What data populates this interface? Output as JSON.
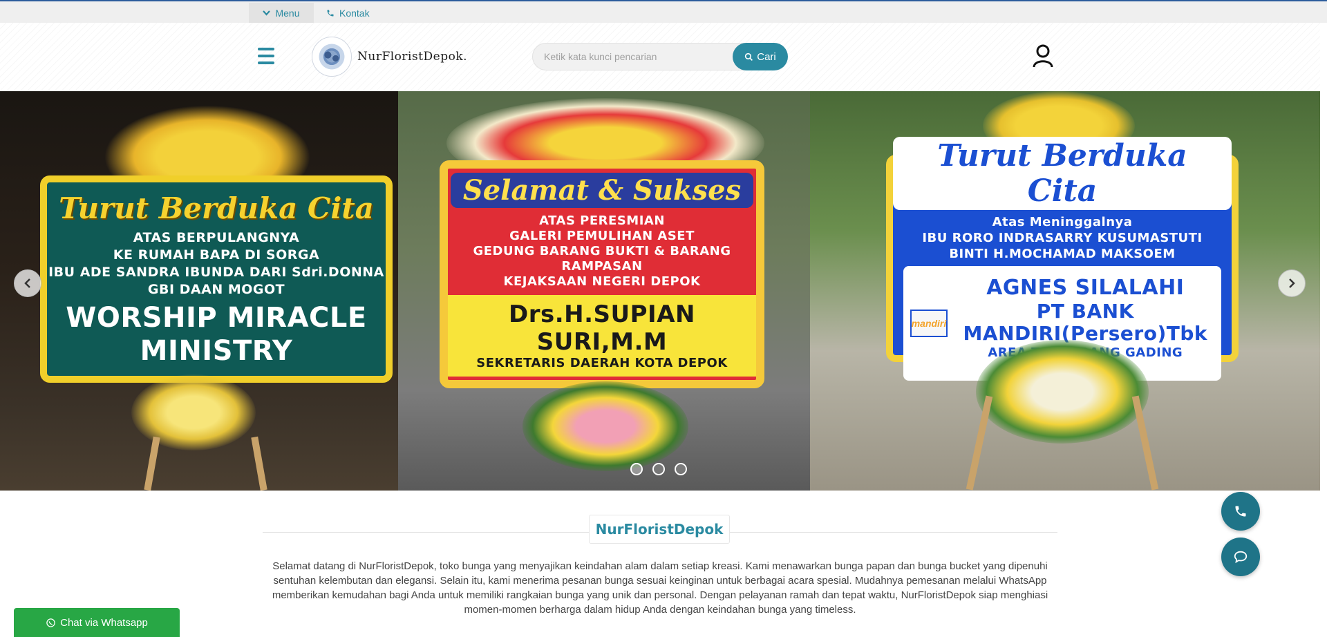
{
  "topbar": {
    "menu_label": "Menu",
    "menu_icon": "chevron-down-icon",
    "kontak_label": "Kontak",
    "kontak_icon": "phone-icon"
  },
  "header": {
    "brand_name": "NurFloristDepok.",
    "search_placeholder": "Ketik kata kunci pencarian",
    "search_button_label": "Cari",
    "search_icon": "search-icon",
    "user_icon": "user-icon"
  },
  "slider": {
    "slides": [
      {
        "script": "Turut Berduka Cita",
        "lines": [
          "ATAS BERPULANGNYA",
          "KE RUMAH BAPA DI SORGA",
          "IBU ADE SANDRA IBUNDA DARI Sdri.DONNA",
          "GBI DAAN MOGOT"
        ],
        "big": "WORSHIP MIRACLE MINISTRY"
      },
      {
        "script": "Selamat & Sukses",
        "lines": [
          "ATAS PERESMIAN",
          "GALERI PEMULIHAN ASET",
          "GEDUNG BARANG BUKTI & BARANG RAMPASAN",
          "KEJAKSAAN NEGERI DEPOK"
        ],
        "name": "Drs.H.SUPIAN SURI,M.M",
        "title": "SEKRETARIS DAERAH KOTA DEPOK"
      },
      {
        "script": "Turut Berduka Cita",
        "lines": [
          "Atas Meninggalnya",
          "IBU RORO INDRASARRY KUSUMASTUTI",
          "BINTI H.MOCHAMAD MAKSOEM"
        ],
        "name": "AGNES SILALAHI",
        "bank_logo": "mandiri",
        "bank": "PT BANK MANDIRI(Persero)Tbk",
        "area": "AREA TANGERANG GADING SERPONG"
      }
    ],
    "active_index": 0,
    "dot_count": 3
  },
  "content": {
    "section_title": "NurFloristDepok",
    "intro": "Selamat datang di NurFloristDepok, toko bunga yang menyajikan keindahan alam dalam setiap kreasi. Kami menawarkan bunga papan dan bunga bucket yang dipenuhi sentuhan kelembutan dan elegansi. Selain itu, kami menerima pesanan bunga sesuai keinginan untuk berbagai acara spesial. Mudahnya pemesanan melalui WhatsApp memberikan kemudahan bagi Anda untuk memiliki rangkaian bunga yang unik dan personal. Dengan pelayanan ramah dan tepat waktu, NurFloristDepok siap menghiasi momen-momen berharga dalam hidup Anda dengan keindahan bunga yang timeless."
  },
  "floating": {
    "whatsapp_label": "Chat via Whatsapp",
    "whatsapp_icon": "whatsapp-icon",
    "phone_icon": "phone-icon",
    "chat_icon": "chat-bubble-icon"
  },
  "colors": {
    "accent": "#2a8aa1",
    "fab": "#1f7488",
    "whatsapp": "#28a745",
    "topbar_border": "#2c5c9c"
  }
}
